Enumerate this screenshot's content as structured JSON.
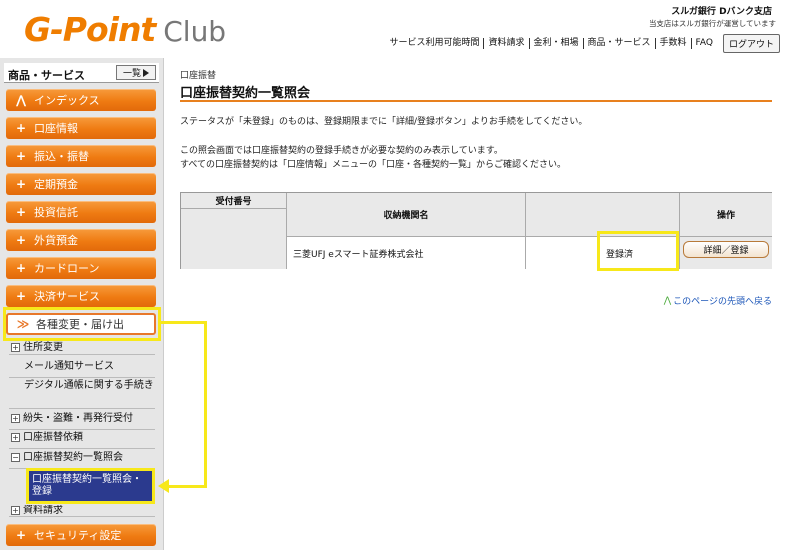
{
  "header": {
    "logo_mark": "G-Point",
    "logo_club": "Club",
    "bank_name": "スルガ銀行 Dバンク支店",
    "bank_note": "当支店はスルガ銀行が運営しています",
    "nav": [
      "サービス利用可能時間",
      "資料請求",
      "金利・相場",
      "商品・サービス",
      "手数料",
      "FAQ"
    ],
    "logout": "ログアウト"
  },
  "sidebar": {
    "title": "商品・サービス",
    "list_button": "一覧",
    "menu": [
      {
        "icon": "double-up-icon",
        "glyph": "⋀",
        "label": "インデックス"
      },
      {
        "icon": "plus-icon",
        "glyph": "+",
        "label": "口座情報"
      },
      {
        "icon": "plus-icon",
        "glyph": "+",
        "label": "振込・振替"
      },
      {
        "icon": "plus-icon",
        "glyph": "+",
        "label": "定期預金"
      },
      {
        "icon": "plus-icon",
        "glyph": "+",
        "label": "投資信託"
      },
      {
        "icon": "plus-icon",
        "glyph": "+",
        "label": "外貨預金"
      },
      {
        "icon": "plus-icon",
        "glyph": "+",
        "label": "カードローン"
      },
      {
        "icon": "plus-icon",
        "glyph": "+",
        "label": "決済サービス"
      }
    ],
    "active_menu": {
      "icon": "double-down-icon",
      "glyph": "≫",
      "label": "各種変更・届け出"
    },
    "sub": [
      {
        "tree": "+",
        "label": "住所変更"
      },
      {
        "tree": "",
        "label": "メール通知サービス"
      },
      {
        "tree": "",
        "label": "デジタル通帳に関する手続き"
      },
      {
        "tree": "+",
        "label": "紛失・盗難・再発行受付"
      },
      {
        "tree": "+",
        "label": "口座振替依頼"
      },
      {
        "tree": "−",
        "label": "口座振替契約一覧照会"
      }
    ],
    "sub_selected": "口座振替契約一覧照会・登録",
    "sub_last": {
      "tree": "+",
      "label": "資料請求"
    },
    "bottom_menu": {
      "icon": "plus-icon",
      "glyph": "+",
      "label": "セキュリティ設定"
    }
  },
  "main": {
    "breadcrumb": "口座振替",
    "title": "口座振替契約一覧照会",
    "msg1": "ステータスが「未登録」のものは、登録期限までに「詳細/登録ボタン」よりお手続をしてください。",
    "msg2": "この照会画面では口座振替契約の登録手続きが必要な契約のみ表示しています。",
    "msg3": "すべての口座振替契約は「口座情報」メニューの「口座・各種契約一覧」からご確認ください。",
    "table": {
      "headers": {
        "receipt_no": "受付番号",
        "institution": "収納機関名",
        "status": "",
        "action": "操作"
      },
      "rows": [
        {
          "receipt_no": "",
          "institution": "三菱UFJ eスマート証券株式会社",
          "status": "登録済",
          "action": "詳細／登録"
        }
      ]
    },
    "page_top": "このページの先頭へ戻る"
  },
  "colors": {
    "accent": "#ef7b12",
    "highlight": "#f7e81a",
    "selected": "#2b3a8e",
    "link": "#1c56b8"
  }
}
